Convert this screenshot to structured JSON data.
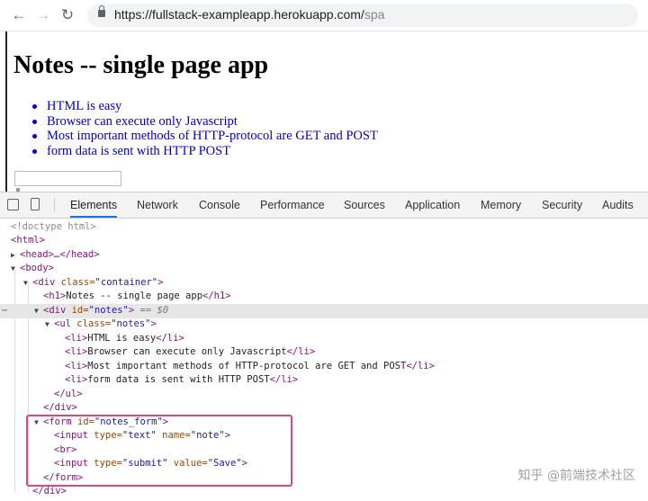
{
  "browser": {
    "url_host": "https://fullstack-exampleapp.herokuapp.com/",
    "url_path": "spa"
  },
  "page": {
    "title": "Notes -- single page app",
    "notes": [
      "HTML is easy",
      "Browser can execute only Javascript",
      "Most important methods of HTTP-protocol are GET and POST",
      "form data is sent with HTTP POST"
    ]
  },
  "devtools": {
    "tabs": [
      "Elements",
      "Network",
      "Console",
      "Performance",
      "Sources",
      "Application",
      "Memory",
      "Security",
      "Audits"
    ],
    "active_tab": "Elements"
  },
  "dom": {
    "doctype": "<!doctype html>",
    "html_open": "<html>",
    "head": "<head>…</head>",
    "body_open": "<body>",
    "container_tag": "<div ",
    "class_attr": "class=",
    "container_val": "\"container\"",
    "h1_open": "<h1>",
    "h1_text": "Notes -- single page app",
    "h1_close": "</h1>",
    "div_open": "<div ",
    "id_attr": "id=",
    "notes_val": "\"notes\"",
    "selected_marker": "== $0",
    "ul_open": "<ul ",
    "ul_class_val": "\"notes\"",
    "li_open": "<li>",
    "li_close": "</li>",
    "ul_close": "</ul>",
    "div_close": "</div>",
    "form_open": "<form ",
    "form_id_val": "\"notes_form\"",
    "input_open": "<input ",
    "type_attr": "type=",
    "text_val": "\"text\"",
    "name_attr": "name=",
    "note_val": "\"note\"",
    "br": "<br>",
    "submit_val": "\"submit\"",
    "value_attr": "value=",
    "save_val": "\"Save\"",
    "form_close": "</form>",
    "tag_end": ">"
  },
  "watermark": "知乎 @前端技术社区",
  "colors": {
    "highlight_border": "#e0457b",
    "active_tab_underline": "#1a73e8",
    "link_blue": "#0000cc"
  }
}
